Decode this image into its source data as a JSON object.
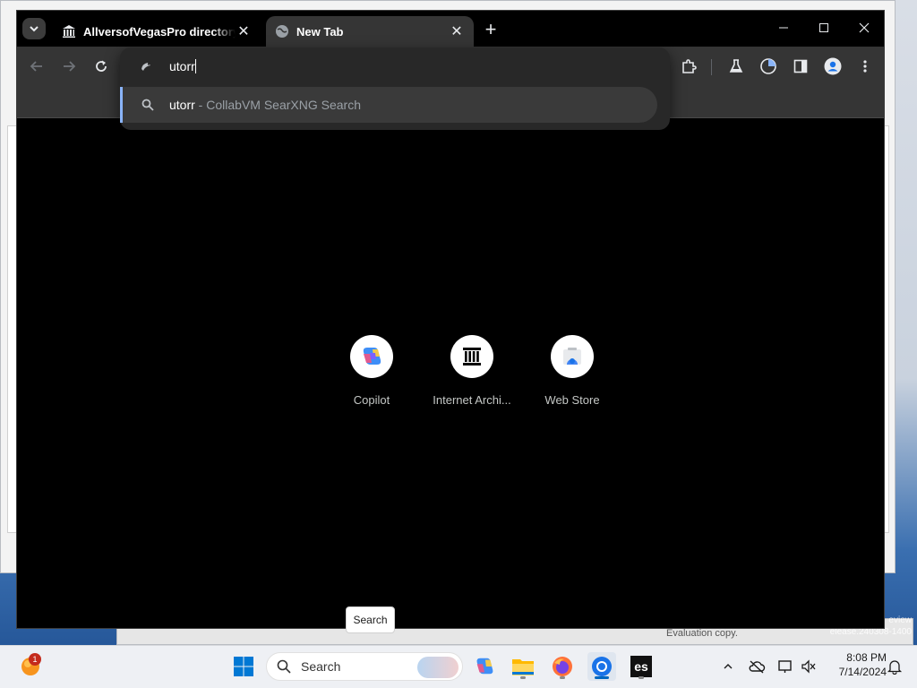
{
  "desktop": {
    "watermark_lines": [
      "eview",
      "elease.240308-1400"
    ],
    "bg_partial_text": "Evaluation copy."
  },
  "browser": {
    "tab_search_icon": "chevron-down-icon",
    "tabs": [
      {
        "title": "AllversofVegasPro directory lis",
        "favicon": "institution-icon",
        "active": false
      },
      {
        "title": "New Tab",
        "favicon": "globe-icon",
        "active": true
      }
    ],
    "new_tab_label": "+",
    "toolbar": {
      "back_icon": "arrow-left-icon",
      "forward_icon": "arrow-right-icon",
      "reload_icon": "reload-icon",
      "extensions_icon": "puzzle-icon",
      "labs_icon": "flask-icon",
      "performance_icon": "gauge-icon",
      "side_panel_icon": "side-panel-icon",
      "profile_icon": "profile-icon",
      "menu_icon": "kebab-menu-icon"
    },
    "omnibox": {
      "input_value": "utorr",
      "suggestion": {
        "query": "utorr",
        "separator": " - ",
        "engine": "CollabVM SearXNG Search"
      }
    },
    "shortcuts": [
      {
        "label": "Copilot",
        "icon": "copilot-icon"
      },
      {
        "label": "Internet Archi...",
        "icon": "institution-icon"
      },
      {
        "label": "Web Store",
        "icon": "webstore-icon"
      }
    ]
  },
  "tooltip": {
    "text": "Search"
  },
  "taskbar": {
    "notification_count": "1",
    "search_placeholder": "Search",
    "clock_time": "8:08 PM",
    "clock_date": "7/14/2024"
  },
  "colors": {
    "omnibox_accent": "#8ab4f8",
    "taskbar_active": "#0067c0",
    "chrome_bg": "#000000"
  }
}
